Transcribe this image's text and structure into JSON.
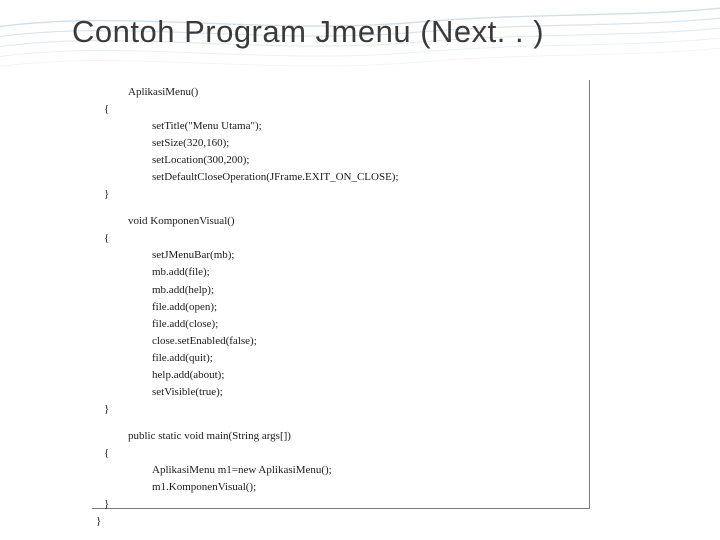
{
  "slide": {
    "title": "Contoh Program Jmenu (Next. . )"
  },
  "code": {
    "l01": "AplikasiMenu()",
    "l02": "{",
    "l03": "setTitle(\"Menu Utama\");",
    "l04": "setSize(320,160);",
    "l05": "setLocation(300,200);",
    "l06": "setDefaultCloseOperation(JFrame.EXIT_ON_CLOSE);",
    "l07": "}",
    "l08": "void KomponenVisual()",
    "l09": "{",
    "l10": "setJMenuBar(mb);",
    "l11": "mb.add(file);",
    "l12": "mb.add(help);",
    "l13": "file.add(open);",
    "l14": "file.add(close);",
    "l15": "close.setEnabled(false);",
    "l16": "file.add(quit);",
    "l17": "help.add(about);",
    "l18": "setVisible(true);",
    "l19": "}",
    "l20": "public static void main(String args[])",
    "l21": "{",
    "l22": "AplikasiMenu m1=new AplikasiMenu();",
    "l23": "m1.KomponenVisual();",
    "l24": "}",
    "l25": "}"
  }
}
